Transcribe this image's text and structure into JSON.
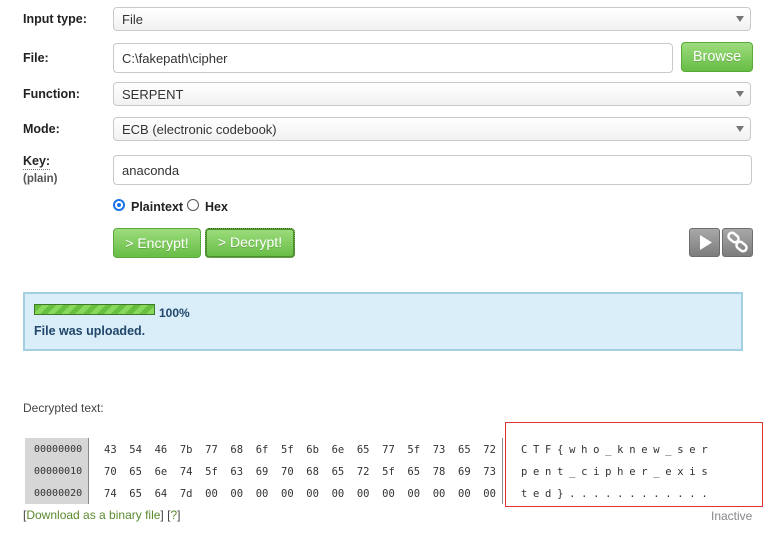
{
  "form": {
    "input_type_label": "Input type:",
    "input_type_value": "File",
    "file_label": "File:",
    "file_value": "C:\\fakepath\\cipher",
    "browse_label": "Browse",
    "function_label": "Function:",
    "function_value": "SERPENT",
    "mode_label": "Mode:",
    "mode_value": "ECB (electronic codebook)",
    "key_label": "Key:",
    "key_sub_label": "(plain)",
    "key_value": "anaconda",
    "radio_plaintext": "Plaintext",
    "radio_hex": "Hex",
    "encrypt_label": "> Encrypt!",
    "decrypt_label": "> Decrypt!"
  },
  "status": {
    "progress_percent": 100,
    "progress_text": "100%",
    "message": "File was uploaded."
  },
  "output": {
    "heading": "Decrypted text:",
    "rows": [
      {
        "offset": "00000000",
        "bytes": "43  54  46  7b  77  68  6f  5f  6b  6e  65  77  5f  73  65  72",
        "ascii": "CTF{who_knew_ser"
      },
      {
        "offset": "00000010",
        "bytes": "70  65  6e  74  5f  63  69  70  68  65  72  5f  65  78  69  73",
        "ascii": "pent_cipher_exis"
      },
      {
        "offset": "00000020",
        "bytes": "74  65  64  7d  00  00  00  00  00  00  00  00  00  00  00  00",
        "ascii": "ted}............"
      }
    ],
    "download_link": "Download as a binary file",
    "help_link": "?",
    "bracket_open": "[",
    "bracket_close": "]",
    "status_text": "Inactive"
  },
  "colors": {
    "green_button": "#67bd45",
    "status_bg": "#d9eef8",
    "highlight_border": "#dd3333"
  },
  "icons": [
    "chevron-down-icon",
    "play-icon",
    "link-icon"
  ]
}
